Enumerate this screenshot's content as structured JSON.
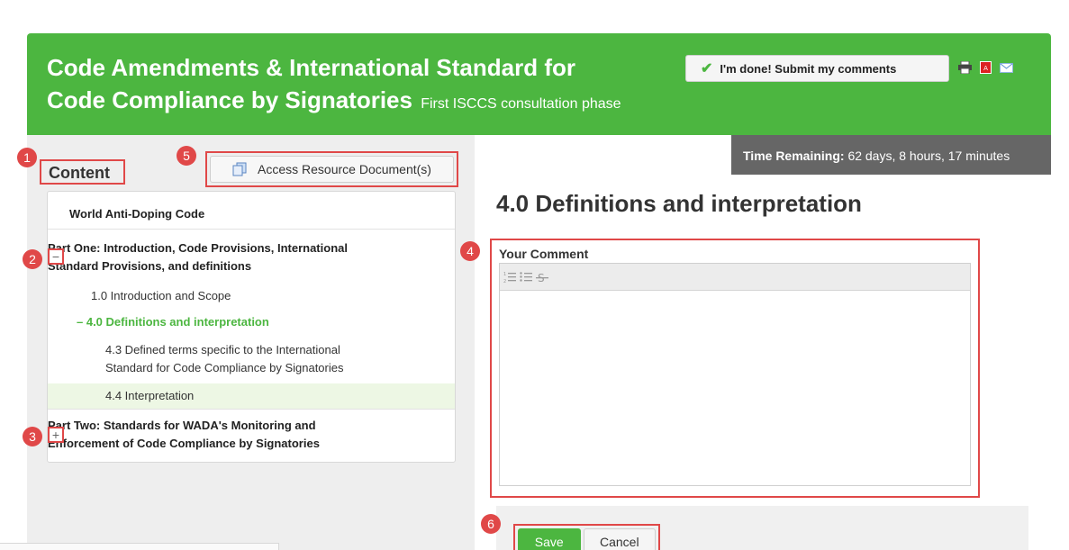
{
  "header": {
    "title_line1": "Code Amendments & International Standard for",
    "title_line2": "Code Compliance by Signatories",
    "subtitle": "First ISCCS consultation phase",
    "done_button": "I'm done! Submit my comments",
    "icons": [
      "print-icon",
      "pdf-icon",
      "email-icon"
    ]
  },
  "sidebar": {
    "content_label": "Content",
    "access_button": "Access Resource Document(s)",
    "nav_top": "World Anti-Doping Code",
    "part_one": {
      "line1": "Part One: Introduction, Code Provisions, International",
      "line2": "Standard Provisions, and definitions",
      "toggle": "−"
    },
    "items": {
      "intro": "1.0 Introduction and Scope",
      "active": "– 4.0 Definitions and interpretation",
      "defined_line1": "4.3 Defined terms specific to the International",
      "defined_line2": "Standard for Code Compliance by Signatories",
      "interpretation": "4.4 Interpretation"
    },
    "part_two": {
      "line1": "Part Two: Standards for WADA's Monitoring and",
      "line2": "Enforcement of Code Compliance by Signatories",
      "toggle": "+"
    }
  },
  "main": {
    "time_label": "Time Remaining:",
    "time_value": "62 days, 8 hours, 17 minutes",
    "section_title": "4.0 Definitions and interpretation",
    "comment_label": "Your Comment",
    "comment_value": "",
    "toolbar_icons": [
      "numbered-list-icon",
      "bullet-list-icon",
      "strikethrough-icon"
    ],
    "save": "Save",
    "cancel": "Cancel"
  },
  "badges": [
    "1",
    "2",
    "3",
    "4",
    "5",
    "6"
  ],
  "colors": {
    "brand_green": "#4cb640",
    "annotation_red": "#e04848",
    "dark_bar": "#666666"
  }
}
